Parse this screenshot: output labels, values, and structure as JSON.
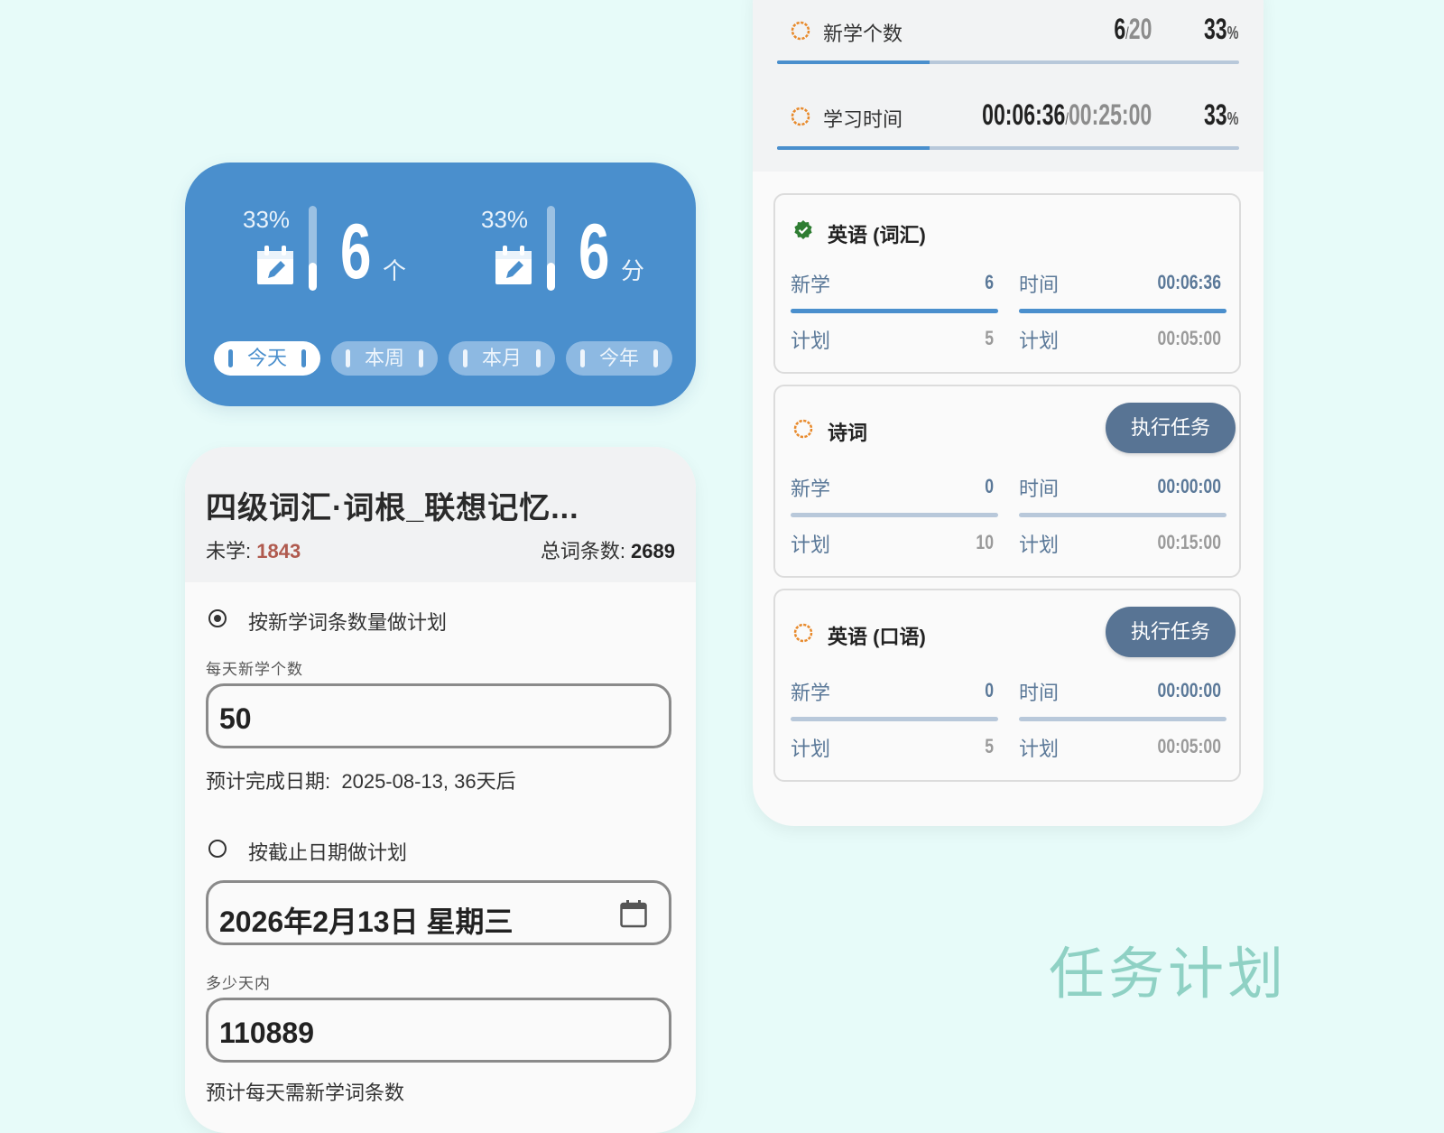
{
  "stats_widget": {
    "new_words": {
      "percent_label": "33%",
      "fraction": 0.33,
      "value": "6",
      "unit": "个",
      "icon": "calendar-edit-icon"
    },
    "study_time": {
      "percent_label": "33%",
      "fraction": 0.33,
      "value": "6",
      "unit": "分",
      "icon": "calendar-edit-icon"
    },
    "periods": [
      {
        "label": "今天",
        "active": true
      },
      {
        "label": "本周",
        "active": false
      },
      {
        "label": "本月",
        "active": false
      },
      {
        "label": "今年",
        "active": false
      }
    ],
    "colors": {
      "background": "#4a8fcd"
    }
  },
  "plan_card": {
    "title": "四级词汇·词根_联想记忆...",
    "unlearned_label": "未学: ",
    "unlearned_value": "1843",
    "total_label": "总词条数: ",
    "total_value": "2689",
    "option_by_count": {
      "label": "按新学词条数量做计划",
      "selected": true,
      "field_label": "每天新学个数",
      "field_value": "50",
      "estimate_label": "预计完成日期:",
      "estimate_value": "2025-08-13, 36天后"
    },
    "option_by_date": {
      "label": "按截止日期做计划",
      "selected": false,
      "date_value": "2026年2月13日 星期三",
      "date_icon": "calendar-icon",
      "days_label": "多少天内",
      "days_value": "110889",
      "footer_partial": "预计每天需新学词条数"
    },
    "colors": {
      "unlearned": "#b05a4e"
    }
  },
  "task_card": {
    "summary": [
      {
        "label": "新学个数",
        "done": "6",
        "slash": "/",
        "target": "20",
        "percent": "33",
        "percent_sign": "%",
        "fraction": 0.33,
        "icon": "pending-ring-icon"
      },
      {
        "label": "学习时间",
        "done": "00:06:36",
        "slash": "/",
        "target": "00:25:00",
        "percent": "33",
        "percent_sign": "%",
        "fraction": 0.33,
        "icon": "pending-ring-icon"
      }
    ],
    "subjects": [
      {
        "title": "英语 (词汇)",
        "status_icon": "check-badge-icon",
        "button": "",
        "new_label": "新学",
        "new_value": "6",
        "new_progress": 1.0,
        "time_label": "时间",
        "time_value": "00:06:36",
        "time_progress": 1.0,
        "plan_label": "计划",
        "plan_new": "5",
        "plan_time": "00:05:00"
      },
      {
        "title": "诗词",
        "status_icon": "pending-ring-icon",
        "button": "执行任务",
        "new_label": "新学",
        "new_value": "0",
        "new_progress": 0.0,
        "time_label": "时间",
        "time_value": "00:00:00",
        "time_progress": 0.0,
        "plan_label": "计划",
        "plan_new": "10",
        "plan_time": "00:15:00"
      },
      {
        "title": "英语 (口语)",
        "status_icon": "pending-ring-icon",
        "button": "执行任务",
        "new_label": "新学",
        "new_value": "0",
        "new_progress": 0.0,
        "time_label": "时间",
        "time_value": "00:00:00",
        "time_progress": 0.0,
        "plan_label": "计划",
        "plan_new": "5",
        "plan_time": "00:05:00"
      }
    ],
    "colors": {
      "accent": "#4a8fcd",
      "button": "#587494",
      "pending": "#e88a2c",
      "done": "#2e7d32"
    }
  },
  "caption": "任务计划"
}
